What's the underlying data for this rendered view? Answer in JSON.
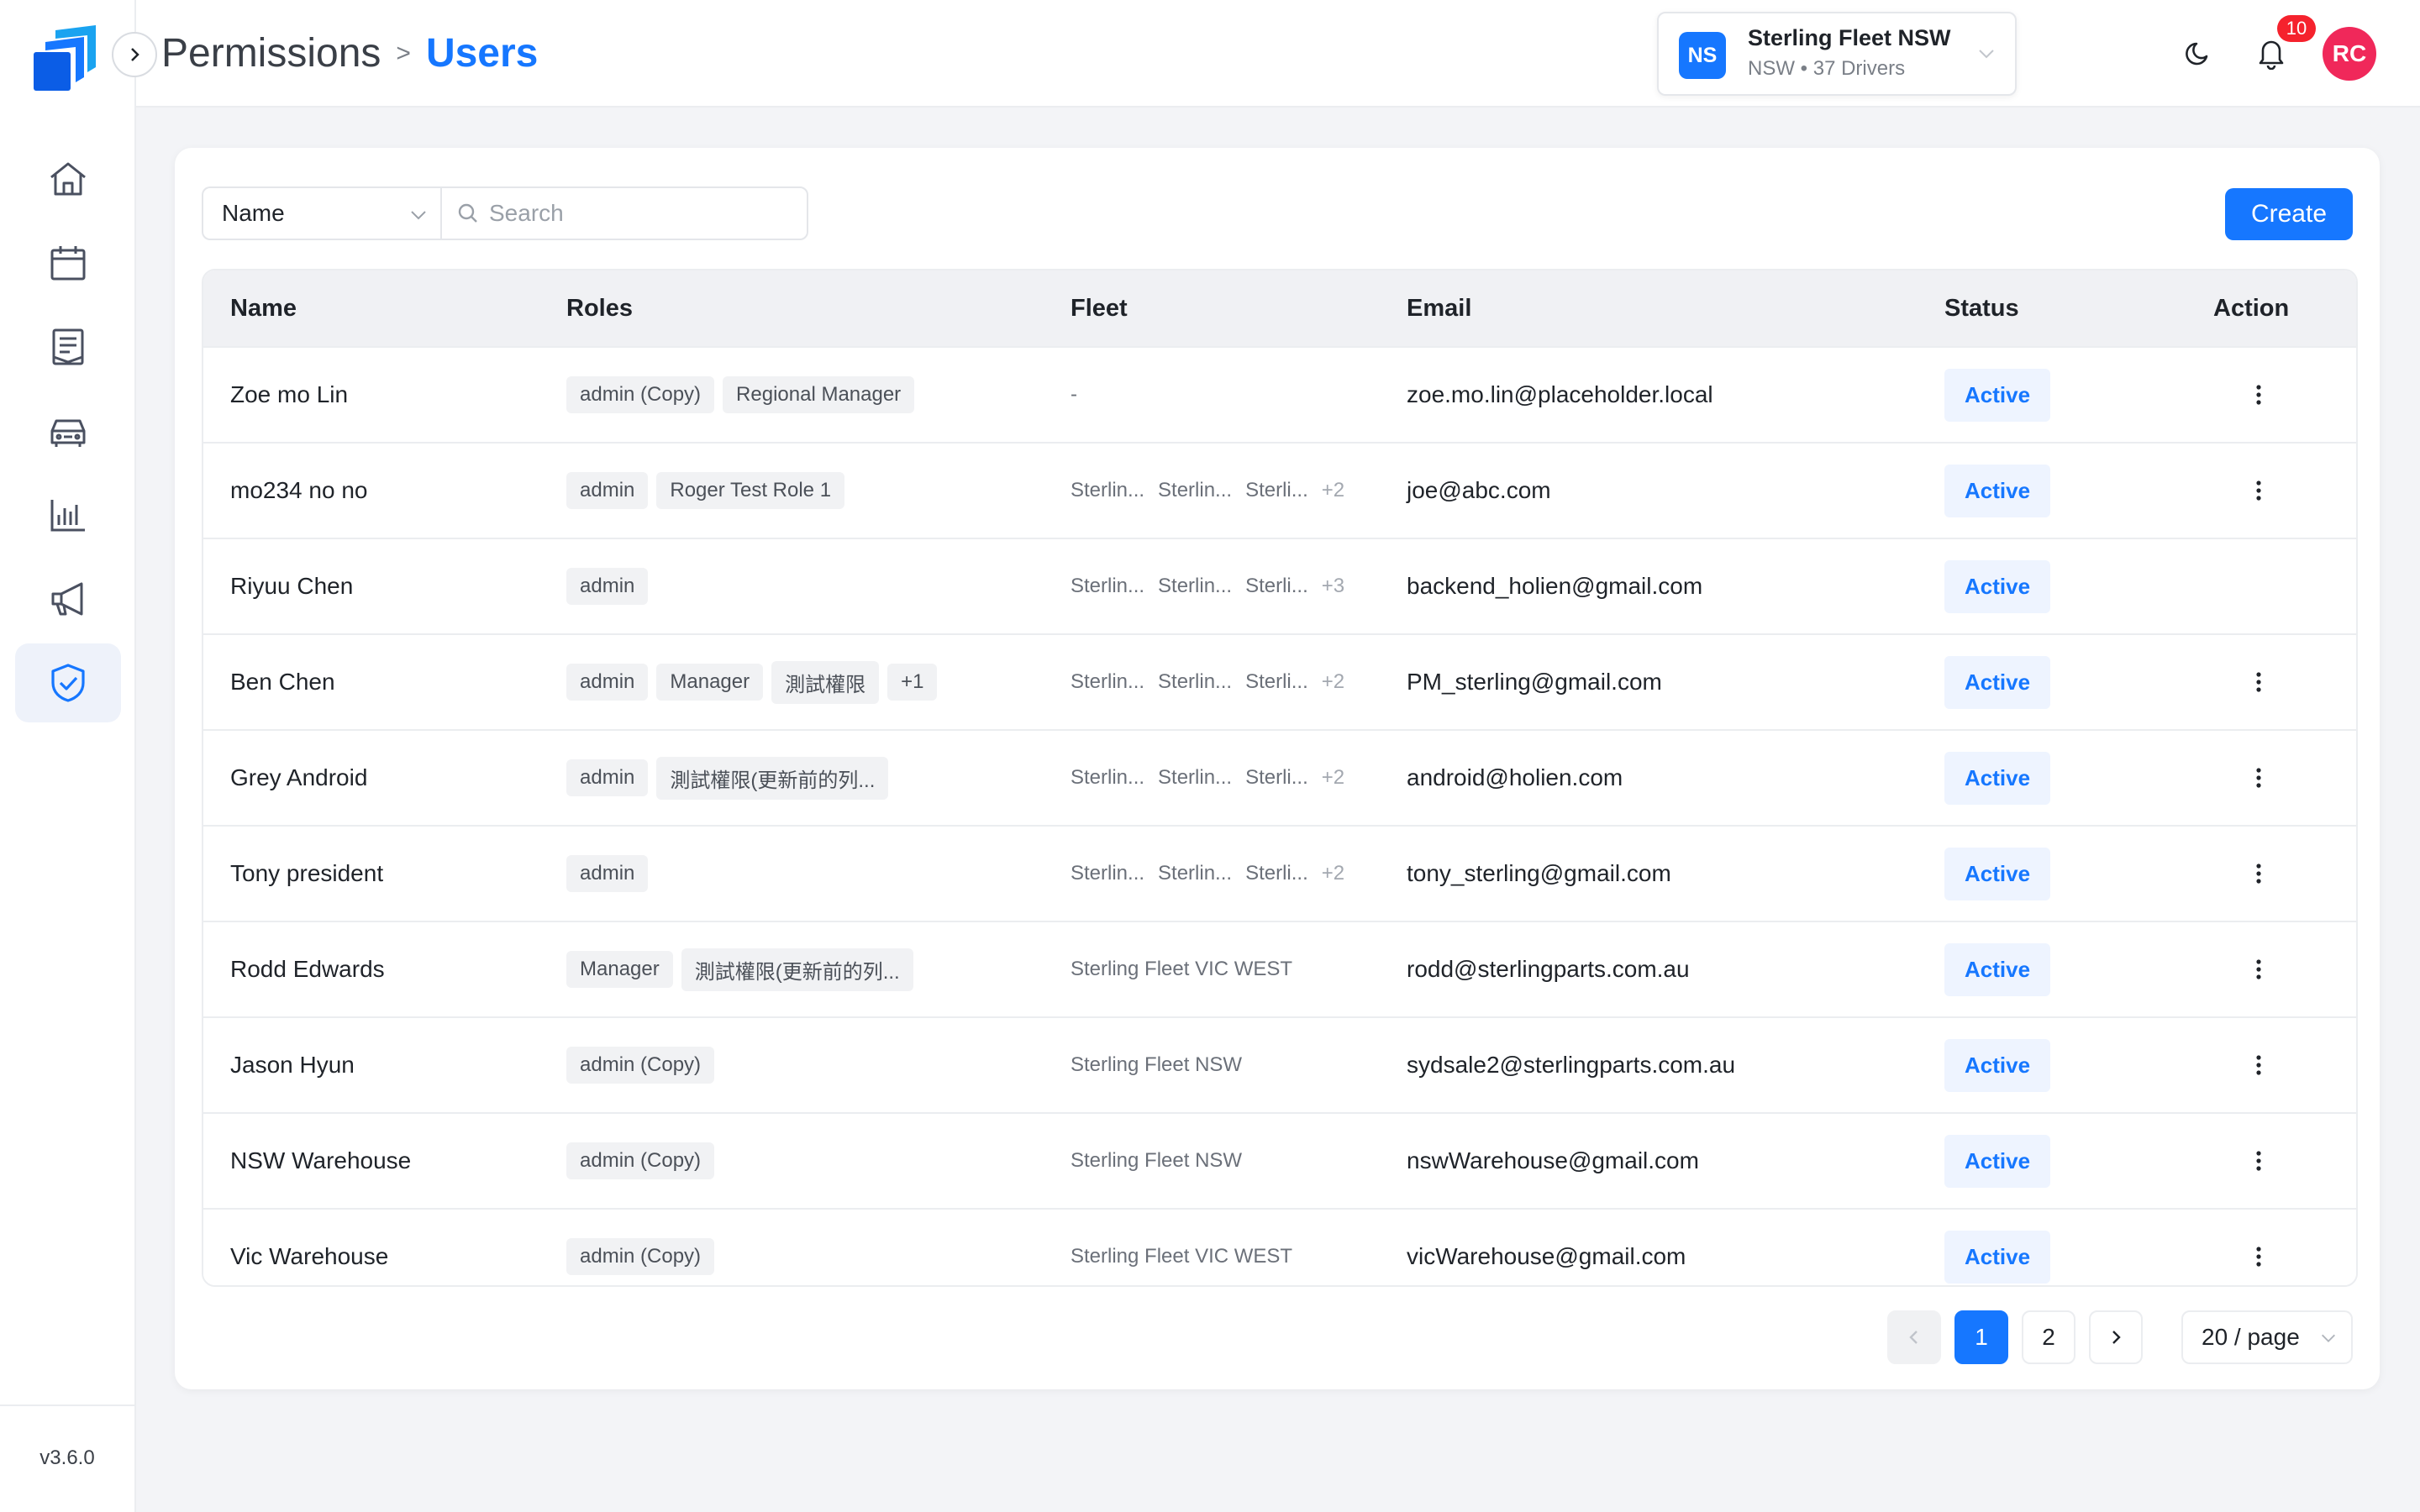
{
  "app": {
    "version": "v3.6.0"
  },
  "breadcrumb": {
    "parent": "Permissions",
    "separator": ">",
    "current": "Users"
  },
  "fleet_switcher": {
    "badge": "NS",
    "name": "Sterling Fleet NSW",
    "subtitle": "NSW • 37 Drivers"
  },
  "notifications": {
    "count": "10"
  },
  "user": {
    "initials": "RC"
  },
  "sidebar": {
    "items": [
      {
        "icon": "home-icon"
      },
      {
        "icon": "calendar-icon"
      },
      {
        "icon": "document-list-icon"
      },
      {
        "icon": "car-icon"
      },
      {
        "icon": "bar-chart-icon"
      },
      {
        "icon": "megaphone-icon"
      },
      {
        "icon": "shield-check-icon",
        "active": true
      }
    ]
  },
  "filter": {
    "field": "Name",
    "search_placeholder": "Search"
  },
  "actions": {
    "create_label": "Create"
  },
  "table": {
    "columns": [
      "Name",
      "Roles",
      "Fleet",
      "Email",
      "Status",
      "Action"
    ],
    "rows": [
      {
        "name": "Zoe mo Lin",
        "roles": [
          "admin (Copy)",
          "Regional Manager"
        ],
        "fleet": [
          "-"
        ],
        "fleet_more": "",
        "email": "zoe.mo.lin@placeholder.local",
        "status": "Active",
        "has_action": true
      },
      {
        "name": "mo234 no no",
        "roles": [
          "admin",
          "Roger Test Role 1"
        ],
        "fleet": [
          "Sterlin...",
          "Sterlin...",
          "Sterli..."
        ],
        "fleet_more": "+2",
        "email": "joe@abc.com",
        "status": "Active",
        "has_action": true
      },
      {
        "name": "Riyuu Chen",
        "roles": [
          "admin"
        ],
        "fleet": [
          "Sterlin...",
          "Sterlin...",
          "Sterli..."
        ],
        "fleet_more": "+3",
        "email": "backend_holien@gmail.com",
        "status": "Active",
        "has_action": false
      },
      {
        "name": "Ben Chen",
        "roles": [
          "admin",
          "Manager",
          "測試權限",
          "+1"
        ],
        "fleet": [
          "Sterlin...",
          "Sterlin...",
          "Sterli..."
        ],
        "fleet_more": "+2",
        "email": "PM_sterling@gmail.com",
        "status": "Active",
        "has_action": true
      },
      {
        "name": "Grey Android",
        "roles": [
          "admin",
          "測試權限(更新前的列..."
        ],
        "fleet": [
          "Sterlin...",
          "Sterlin...",
          "Sterli..."
        ],
        "fleet_more": "+2",
        "email": "android@holien.com",
        "status": "Active",
        "has_action": true
      },
      {
        "name": "Tony president",
        "roles": [
          "admin"
        ],
        "fleet": [
          "Sterlin...",
          "Sterlin...",
          "Sterli..."
        ],
        "fleet_more": "+2",
        "email": "tony_sterling@gmail.com",
        "status": "Active",
        "has_action": true
      },
      {
        "name": "Rodd Edwards",
        "roles": [
          "Manager",
          "測試權限(更新前的列..."
        ],
        "fleet": [
          "Sterling Fleet VIC WEST"
        ],
        "fleet_more": "",
        "email": "rodd@sterlingparts.com.au",
        "status": "Active",
        "has_action": true
      },
      {
        "name": "Jason Hyun",
        "roles": [
          "admin (Copy)"
        ],
        "fleet": [
          "Sterling Fleet NSW"
        ],
        "fleet_more": "",
        "email": "sydsale2@sterlingparts.com.au",
        "status": "Active",
        "has_action": true
      },
      {
        "name": "NSW Warehouse",
        "roles": [
          "admin (Copy)"
        ],
        "fleet": [
          "Sterling Fleet NSW"
        ],
        "fleet_more": "",
        "email": "nswWarehouse@gmail.com",
        "status": "Active",
        "has_action": true
      },
      {
        "name": "Vic Warehouse",
        "roles": [
          "admin (Copy)"
        ],
        "fleet": [
          "Sterling Fleet VIC WEST"
        ],
        "fleet_more": "",
        "email": "vicWarehouse@gmail.com",
        "status": "Active",
        "has_action": true
      }
    ]
  },
  "pagination": {
    "pages": [
      "1",
      "2"
    ],
    "current": "1",
    "page_size": "20 / page"
  },
  "colors": {
    "accent": "#1677ff",
    "notification": "#f5222d",
    "avatar": "#f0285a"
  }
}
